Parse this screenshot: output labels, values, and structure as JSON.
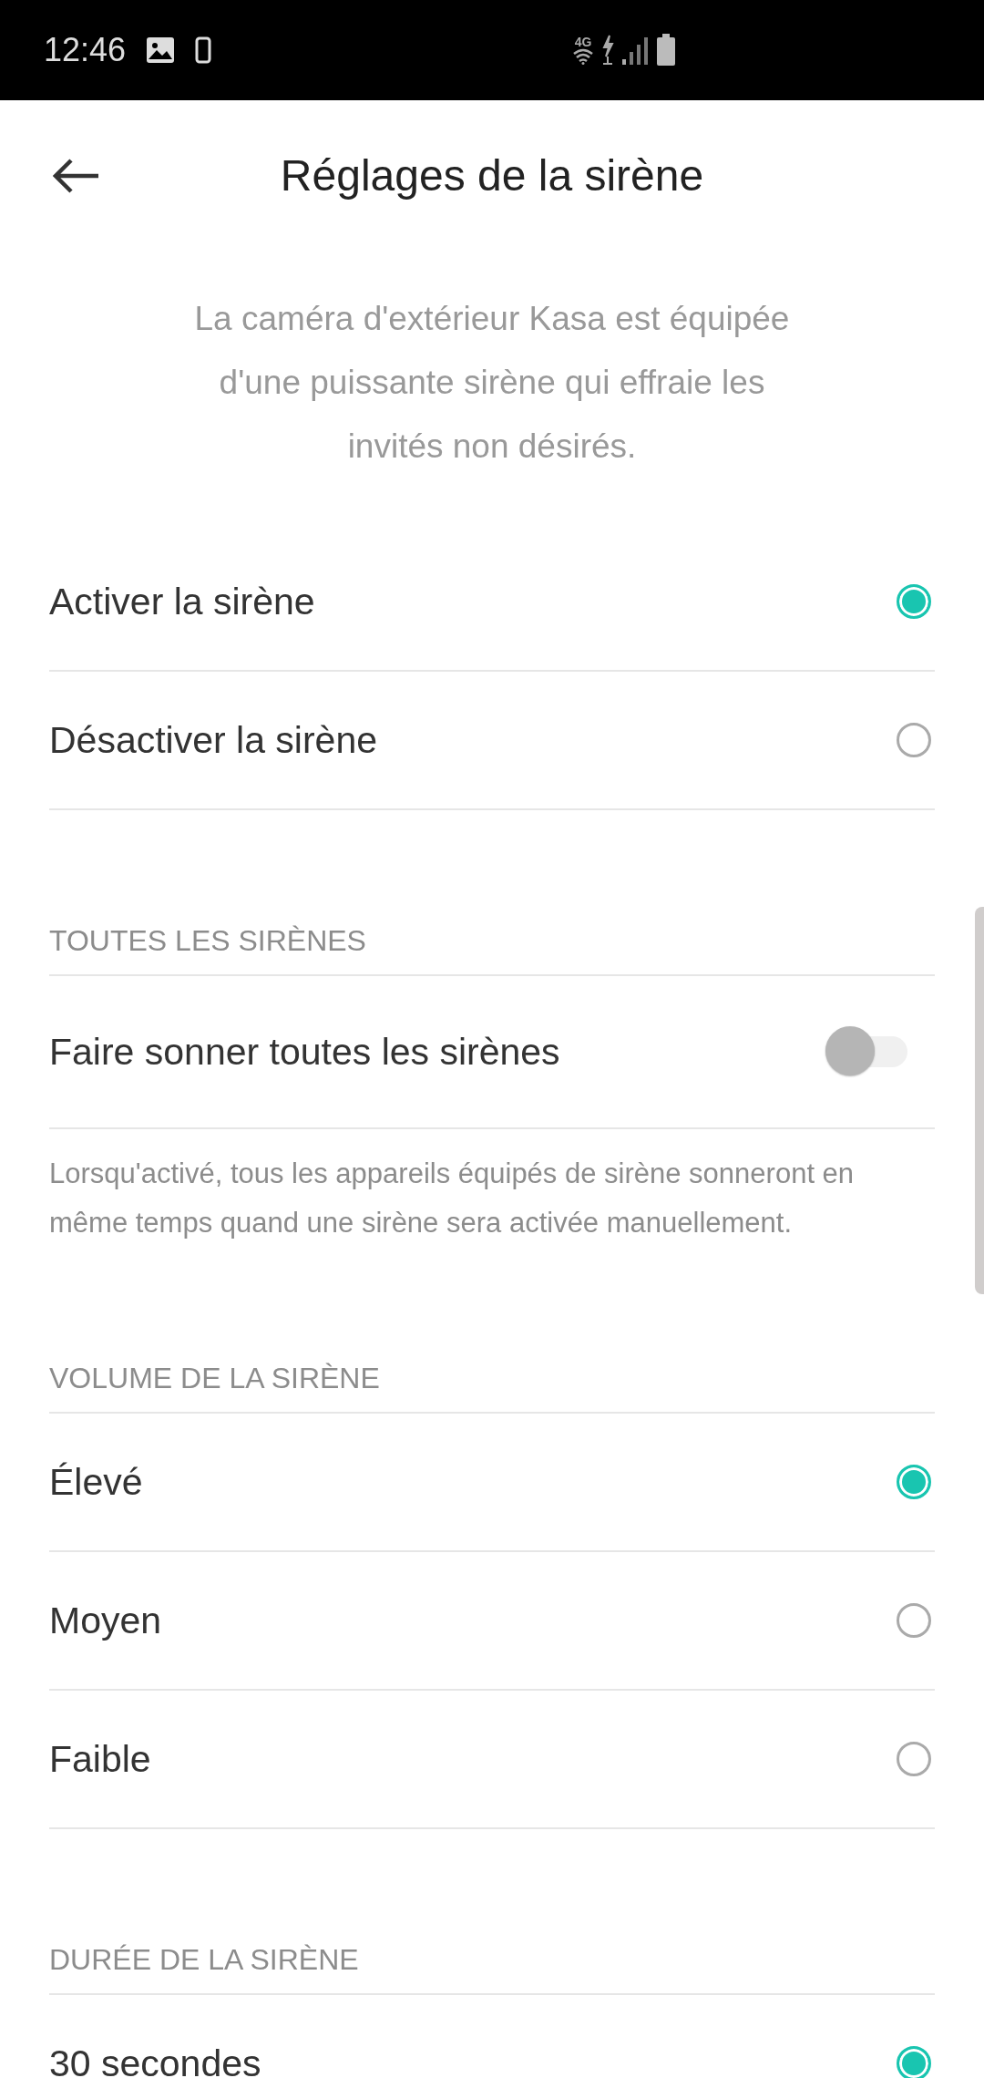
{
  "status_bar": {
    "time": "12:46",
    "network": "4G"
  },
  "header": {
    "title": "Réglages de la sirène"
  },
  "description": "La caméra d'extérieur Kasa est équipée d'une puissante sirène qui effraie les invités non désirés.",
  "siren_mode": [
    {
      "label": "Activer la sirène",
      "selected": true
    },
    {
      "label": "Désactiver la sirène",
      "selected": false
    }
  ],
  "all_sirens": {
    "heading": "TOUTES LES SIRÈNES",
    "label": "Faire sonner toutes les sirènes",
    "on": false,
    "note": "Lorsqu'activé, tous les appareils équipés de sirène sonneront en même temps quand une sirène sera activée manuellement."
  },
  "volume": {
    "heading": "VOLUME DE LA SIRÈNE",
    "options": [
      {
        "label": "Élevé",
        "selected": true
      },
      {
        "label": "Moyen",
        "selected": false
      },
      {
        "label": "Faible",
        "selected": false
      }
    ]
  },
  "duration": {
    "heading": "DURÉE DE LA SIRÈNE",
    "options": [
      {
        "label": "30 secondes",
        "selected": true
      }
    ]
  }
}
